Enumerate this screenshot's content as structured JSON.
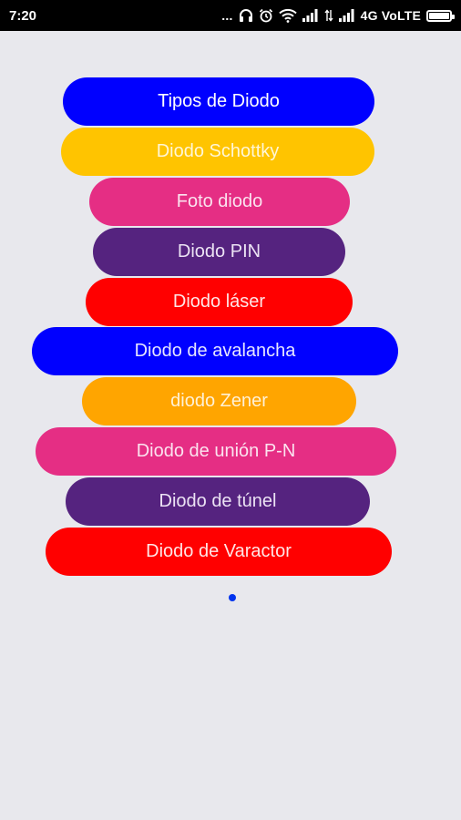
{
  "status_bar": {
    "time": "7:20",
    "dots": "...",
    "network_label": "4G VoLTE",
    "icons": [
      "headphones-icon",
      "alarm-icon",
      "wifi-icon",
      "signal-icon",
      "data-arrows-icon",
      "signal-icon",
      "battery-icon"
    ],
    "battery_level": 1.0
  },
  "buttons": [
    {
      "label": "Tipos de Diodo",
      "color": "#0000ff",
      "text_color": "#ffffff"
    },
    {
      "label": "Diodo Schottky",
      "color": "#ffc400",
      "text_color": "#fff6d6"
    },
    {
      "label": "Foto diodo",
      "color": "#e52e84",
      "text_color": "#fbe3ef"
    },
    {
      "label": "Diodo PIN",
      "color": "#55237f",
      "text_color": "#ece3f4"
    },
    {
      "label": "Diodo láser",
      "color": "#ff0000",
      "text_color": "#ffe6e6"
    },
    {
      "label": "Diodo de avalancha",
      "color": "#0000ff",
      "text_color": "#e6e6ff"
    },
    {
      "label": "diodo Zener",
      "color": "#ffa500",
      "text_color": "#fff1d6"
    },
    {
      "label": "Diodo de unión P-N",
      "color": "#e52e84",
      "text_color": "#fbe3ef"
    },
    {
      "label": "Diodo de túnel",
      "color": "#55237f",
      "text_color": "#ece3f4"
    },
    {
      "label": "Diodo de Varactor",
      "color": "#ff0000",
      "text_color": "#ffe6e6"
    }
  ],
  "page_indicator": {
    "color": "#0033ee"
  }
}
